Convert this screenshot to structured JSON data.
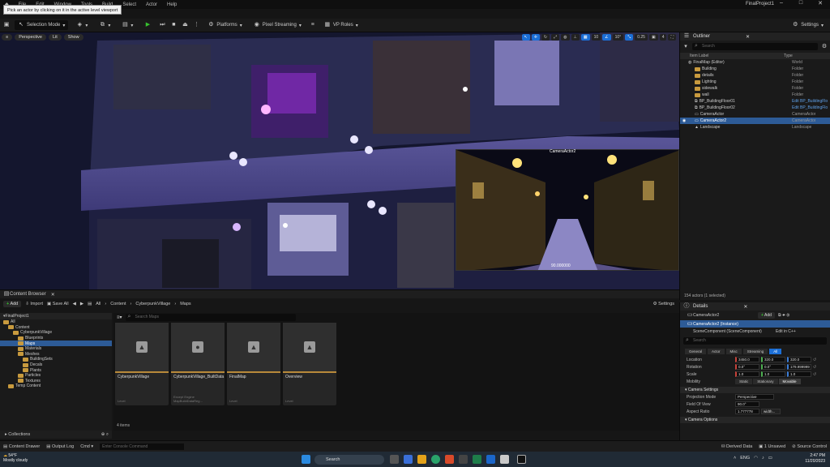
{
  "menu": [
    "File",
    "Edit",
    "Window",
    "Tools",
    "Build",
    "Select",
    "Actor",
    "Help"
  ],
  "tooltip": "Pick an actor by clicking on it in the active level viewport",
  "window_title": "FinalProject1",
  "toolbar": {
    "mode": "Selection Mode",
    "platforms": "Platforms",
    "pixel_streaming": "Pixel Streaming",
    "vp_roles": "VP Roles",
    "settings": "Settings"
  },
  "viewport": {
    "perspective": "Perspective",
    "lit": "Lit",
    "show": "Show",
    "camera_label": "CameraActor2",
    "fov_value": "90.000000",
    "snap_values": [
      "10",
      "10°",
      "0.25",
      "4"
    ]
  },
  "outliner": {
    "tab": "Outliner",
    "search_placeholder": "Search",
    "col_label": "Item Label",
    "col_type": "Type",
    "rows": [
      {
        "label": "FinalMap (Editor)",
        "type": "World",
        "kind": "world",
        "indent": 0
      },
      {
        "label": "Building",
        "type": "Folder",
        "kind": "folder",
        "indent": 1
      },
      {
        "label": "details",
        "type": "Folder",
        "kind": "folder",
        "indent": 1
      },
      {
        "label": "Lighting",
        "type": "Folder",
        "kind": "folder",
        "indent": 1
      },
      {
        "label": "sidewalk",
        "type": "Folder",
        "kind": "folder",
        "indent": 1
      },
      {
        "label": "wall",
        "type": "Folder",
        "kind": "folder",
        "indent": 1
      },
      {
        "label": "BP_BuildingFloor01",
        "type": "Edit BP_BuildingFlo",
        "kind": "bp",
        "indent": 1
      },
      {
        "label": "BP_BuildingFloor02",
        "type": "Edit BP_BuildingFlo",
        "kind": "bp",
        "indent": 1
      },
      {
        "label": "CameraActor",
        "type": "CameraActor",
        "kind": "cam",
        "indent": 1
      },
      {
        "label": "CameraActor2",
        "type": "CameraActor",
        "kind": "cam",
        "indent": 1,
        "selected": true
      },
      {
        "label": "Landscape",
        "type": "Landscape",
        "kind": "land",
        "indent": 1
      }
    ],
    "footer": "154 actors (1 selected)"
  },
  "content_browser": {
    "tab": "Content Browser",
    "add": "Add",
    "import": "Import",
    "save_all": "Save All",
    "path": [
      "All",
      "Content",
      "CyberpunkVillage",
      "Maps"
    ],
    "settings": "Settings",
    "search_placeholder": "Search Maps",
    "tree": [
      {
        "label": "FinalProject1",
        "indent": 0,
        "kind": "root"
      },
      {
        "label": "All",
        "indent": 0
      },
      {
        "label": "Content",
        "indent": 1
      },
      {
        "label": "CyberpunkVillage",
        "indent": 2
      },
      {
        "label": "Blueprints",
        "indent": 3
      },
      {
        "label": "Maps",
        "indent": 3,
        "selected": true
      },
      {
        "label": "Materials",
        "indent": 3
      },
      {
        "label": "Meshes",
        "indent": 3
      },
      {
        "label": "BuildingSets",
        "indent": 4
      },
      {
        "label": "Decals",
        "indent": 4
      },
      {
        "label": "Plants",
        "indent": 4
      },
      {
        "label": "Particles",
        "indent": 3
      },
      {
        "label": "Textures",
        "indent": 3
      },
      {
        "label": "Temp Content",
        "indent": 1
      }
    ],
    "assets": [
      {
        "name": "CyberpunkVillage",
        "type": "Level",
        "icon": "level"
      },
      {
        "name": "CyberpunkVillage_BuiltData",
        "type": "Except Engine MapBuildDataReg...",
        "icon": "data"
      },
      {
        "name": "FinalMap",
        "type": "Level",
        "icon": "level"
      },
      {
        "name": "Overview",
        "type": "Level",
        "icon": "level"
      }
    ],
    "count": "4 items",
    "collections": "Collections"
  },
  "details": {
    "tab": "Details",
    "actor": "CameraActor2",
    "add": "Add",
    "instance": "CameraActor2 (Instance)",
    "component": "SceneComponent (SceneComponent)",
    "edit_cpp": "Edit in C++",
    "search_placeholder": "Search",
    "filters": [
      "General",
      "Actor",
      "Misc",
      "Streaming",
      "All"
    ],
    "transform": [
      {
        "label": "Location",
        "values": [
          "3450.0",
          "320.0",
          "320.0"
        ]
      },
      {
        "label": "Rotation",
        "values": [
          "0.0°",
          "0.0°",
          "179.999999"
        ]
      },
      {
        "label": "Scale",
        "values": [
          "1.0",
          "1.0",
          "1.0"
        ]
      }
    ],
    "mobility_label": "Mobility",
    "mobility": [
      "Static",
      "Stationary",
      "Movable"
    ],
    "camera_settings": "Camera Settings",
    "projection_label": "Projection Mode",
    "projection_value": "Perspective",
    "fov_label": "Field Of View",
    "fov_value": "90.0°",
    "aspect_label": "Aspect Ratio",
    "aspect_value": "1.777778",
    "aspect_preset": "width...",
    "camera_options": "Camera Options"
  },
  "statusbar": {
    "content_drawer": "Content Drawer",
    "output_log": "Output Log",
    "cmd": "Cmd",
    "console_placeholder": "Enter Console Command",
    "derived": "Derived Data",
    "unsaved": "1 Unsaved",
    "source_control": "Source Control"
  },
  "taskbar": {
    "temp": "54°F",
    "weather": "Mostly cloudy",
    "search": "Search",
    "lang": "ENG",
    "time": "2:47 PM",
    "date": "11/20/2023"
  }
}
